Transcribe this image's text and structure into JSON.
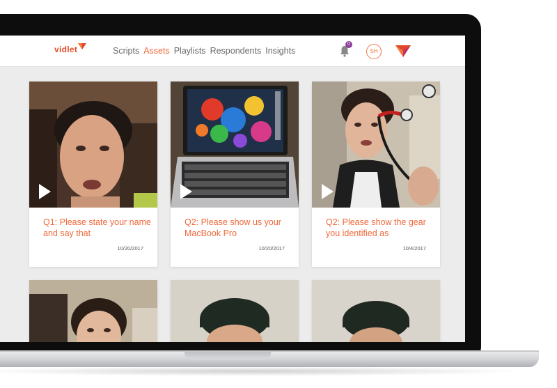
{
  "app": {
    "logo_text": "vidlet",
    "nav": [
      {
        "label": "Scripts",
        "active": false
      },
      {
        "label": "Assets",
        "active": true
      },
      {
        "label": "Playlists",
        "active": false
      },
      {
        "label": "Respondents",
        "active": false
      },
      {
        "label": "Insights",
        "active": false
      }
    ],
    "notifications_count": "0",
    "user_initials": "SH"
  },
  "colors": {
    "accent": "#f06a3a",
    "brand_red": "#e04e2c",
    "badge": "#8a3e9a"
  },
  "assets": [
    {
      "title": "Q1: Please state your name and say that",
      "date": "10/20/2017",
      "thumb": "woman-face"
    },
    {
      "title": "Q2: Please show us your MacBook Pro",
      "date": "10/20/2017",
      "thumb": "macbook"
    },
    {
      "title": "Q2: Please show the gear you identified as",
      "date": "10/4/2017",
      "thumb": "woman-headphones"
    },
    {
      "thumb": "woman-face-2"
    },
    {
      "thumb": "man-cap"
    },
    {
      "thumb": "man-cap-2"
    }
  ]
}
